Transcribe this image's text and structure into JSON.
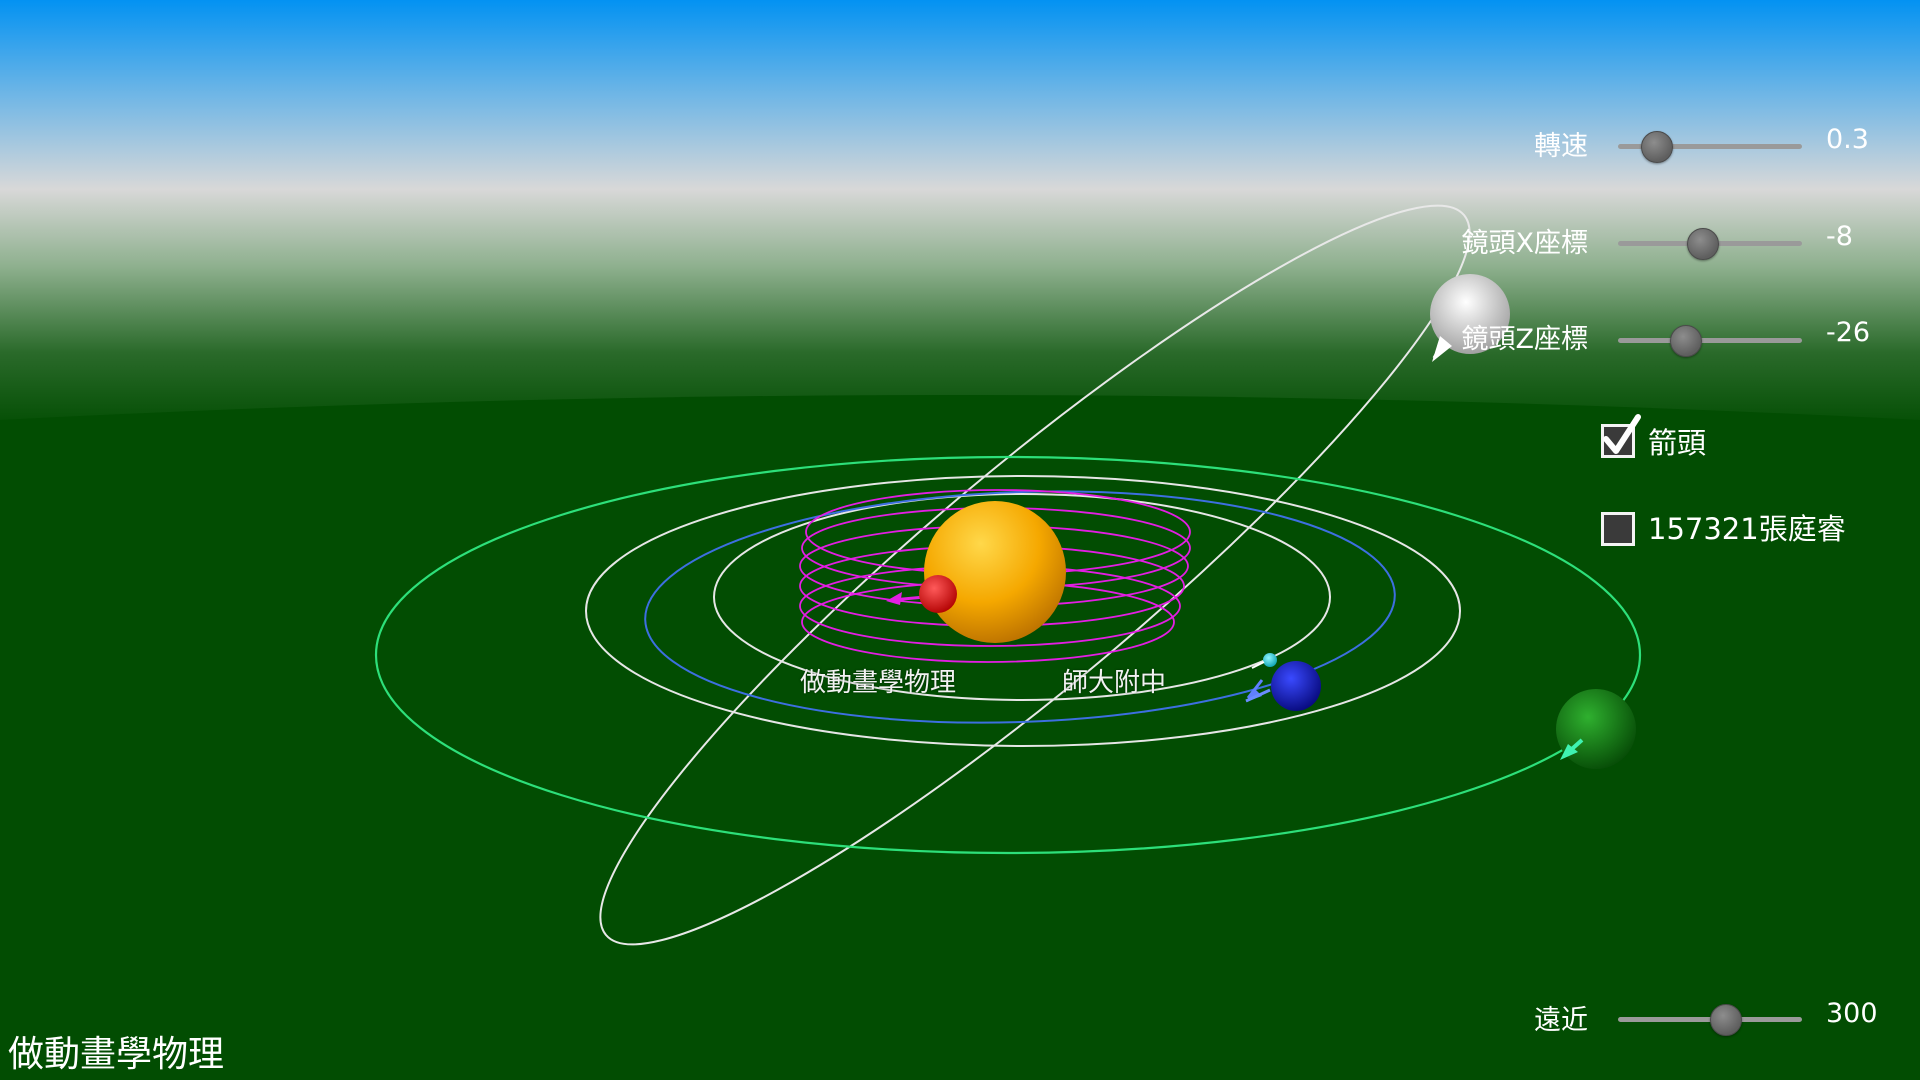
{
  "scene": {
    "labels": {
      "physics": "做動畫學物理",
      "school": "師大附中"
    }
  },
  "controls": {
    "speed": {
      "label": "轉速",
      "value": "0.3",
      "level": 0.15
    },
    "camera_x": {
      "label": "鏡頭X座標",
      "value": "-8",
      "level": 0.45
    },
    "camera_z": {
      "label": "鏡頭Z座標",
      "value": "-26",
      "level": 0.34
    },
    "arrows": {
      "label": "箭頭",
      "checked": true
    },
    "student": {
      "label": "157321張庭睿",
      "checked": false
    },
    "distance": {
      "label": "遠近",
      "value": "300",
      "level": 0.6
    }
  },
  "watermark": "做動畫學物理",
  "colors": {
    "sky_top": "#0392f2",
    "horizon": "#d6d6d6",
    "ground": "#024d02",
    "sun": "#f5a800",
    "planet_red": "#e60000",
    "planet_blue": "#0b10d8",
    "planet_green": "#0d8a0d",
    "comet_white": "#f0f0f0",
    "moon_cyan": "#18d8e0",
    "magenta_orbit": "#e31ee3",
    "green_orbit": "#2de07a"
  }
}
